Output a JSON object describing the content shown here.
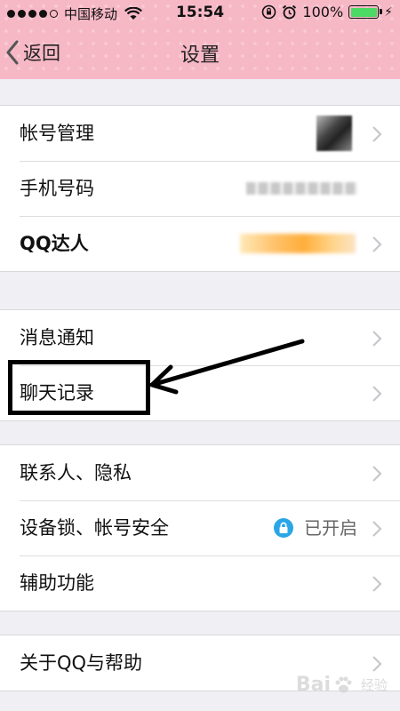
{
  "status_bar": {
    "carrier": "中国移动",
    "time": "15:54",
    "battery": "100%"
  },
  "nav": {
    "back_label": "返回",
    "title": "设置"
  },
  "groups": [
    {
      "items": [
        {
          "label": "帐号管理"
        },
        {
          "label": "手机号码"
        },
        {
          "label": "QQ达人"
        }
      ]
    },
    {
      "items": [
        {
          "label": "消息通知"
        },
        {
          "label": "聊天记录"
        }
      ]
    },
    {
      "items": [
        {
          "label": "联系人、隐私"
        },
        {
          "label": "设备锁、帐号安全",
          "value": "已开启"
        },
        {
          "label": "辅助功能"
        }
      ]
    },
    {
      "items": [
        {
          "label": "关于QQ与帮助"
        }
      ]
    }
  ],
  "watermark": {
    "brand": "Bai",
    "brand_suffix": "经验"
  },
  "colors": {
    "header_pink": "#f7b8c6",
    "background": "#efeff4",
    "lock_blue": "#2aa6e6",
    "battery_green": "#4cd964",
    "annotation": "#000000"
  },
  "icons": [
    "signal-dots",
    "wifi-icon",
    "orientation-lock-icon",
    "alarm-icon",
    "battery-icon",
    "charging-icon",
    "back-chevron-icon",
    "chevron-right-icon",
    "lock-icon",
    "baidu-paw-icon"
  ]
}
